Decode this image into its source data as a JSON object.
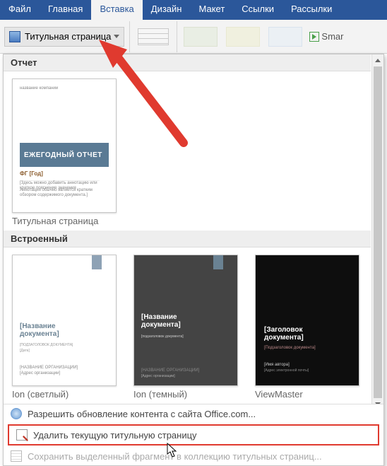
{
  "tabs": {
    "file": "Файл",
    "home": "Главная",
    "insert": "Вставка",
    "design": "Дизайн",
    "layout": "Макет",
    "references": "Ссылки",
    "mailings": "Рассылки"
  },
  "ribbon": {
    "cover_page_btn": "Титульная страница",
    "smartart_label": "Smar"
  },
  "gallery": {
    "section_report": "Отчет",
    "section_builtin": "Встроенный",
    "tile_report": {
      "caption": "Титульная страница",
      "bar_text": "ЕЖЕГОДНЫЙ ОТЧЕТ",
      "sub": "ФГ [Год]",
      "top": "название компании",
      "tiny_a": "[Здесь можно добавить аннотацию или краткое пояснение значения",
      "tiny_b": "Аннотация обычно является кратким обзором содержимого документа.]"
    },
    "tile_ion_light": {
      "caption": "Ion (светлый)",
      "title": "[Название документа]",
      "s1": "[ПОДЗАГОЛОВОК ДОКУМЕНТА]",
      "s2": "[Дата]",
      "b1": "[НАЗВАНИЕ ОРГАНИЗАЦИИ]",
      "b2": "[Адрес организации]"
    },
    "tile_ion_dark": {
      "caption": "Ion (темный)",
      "title": "[Название документа]",
      "small": "[подзаголовок документа]",
      "b1": "[НАЗВАНИЕ ОРГАНИЗАЦИИ]",
      "b2": "[Адрес организации]"
    },
    "tile_viewmaster": {
      "caption": "ViewMaster",
      "title": "[Заголовок документа]",
      "small": "[Подзаголовок документа]",
      "b1": "[Имя автора]",
      "b2": "[Адрес электронной почты]"
    }
  },
  "footer": {
    "allow_update": "Разрешить обновление контента с сайта Office.com...",
    "remove_cover": "Удалить текущую титульную страницу",
    "save_selection": "Сохранить выделенный фрагмент в коллекцию титульных страниц..."
  }
}
